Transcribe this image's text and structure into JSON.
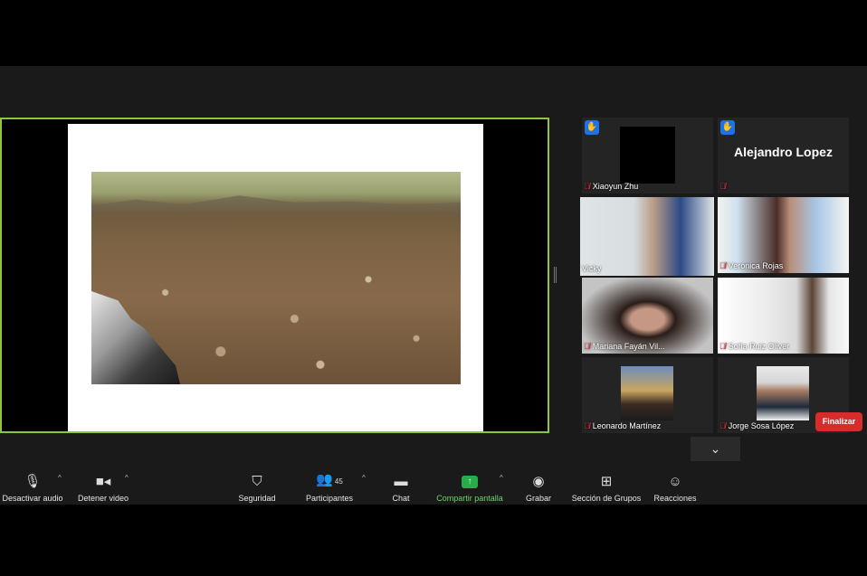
{
  "participants": [
    {
      "name": "Xiaoyun Zhu",
      "muted": true,
      "hand_raised": true,
      "video": "off"
    },
    {
      "name": "Alejandro Lopez",
      "muted": true,
      "hand_raised": true,
      "video": "off"
    },
    {
      "name": "Vicky",
      "muted": false,
      "hand_raised": false,
      "video": "on",
      "active_speaker": true
    },
    {
      "name": "Verónica Rojas",
      "muted": true,
      "hand_raised": false,
      "video": "on"
    },
    {
      "name": "Mariana Fayán Vil...",
      "muted": true,
      "hand_raised": false,
      "video": "on"
    },
    {
      "name": "Sofía Ruiz Oliver",
      "muted": true,
      "hand_raised": false,
      "video": "on"
    },
    {
      "name": "Leonardo Martínez",
      "muted": true,
      "hand_raised": false,
      "video": "photo"
    },
    {
      "name": "Jorge Sosa López",
      "muted": true,
      "hand_raised": false,
      "video": "photo"
    }
  ],
  "toolbar": {
    "mute": "Desactivar audio",
    "video": "Detener video",
    "security": "Seguridad",
    "participants": "Participantes",
    "participants_count": "45",
    "chat": "Chat",
    "share": "Compartir pantalla",
    "record": "Grabar",
    "breakout": "Sección de Grupos",
    "reactions": "Reacciones",
    "end": "Finalizar"
  },
  "icons": {
    "mic": "microphone-icon",
    "camera": "video-camera-icon",
    "shield": "shield-icon",
    "people": "participants-icon",
    "chat": "chat-bubble-icon",
    "share": "share-screen-icon",
    "record": "record-icon",
    "breakout": "grid-icon",
    "reactions": "emoji-icon",
    "hand": "raised-hand-icon",
    "muted": "muted-mic-icon",
    "chevron": "chevron-down-icon"
  },
  "colors": {
    "active_border": "#8dc63f",
    "share_green": "#27ae4a",
    "end_red": "#d62c2c",
    "muted_red": "#e0303a",
    "hand_blue": "#1a73e8"
  }
}
